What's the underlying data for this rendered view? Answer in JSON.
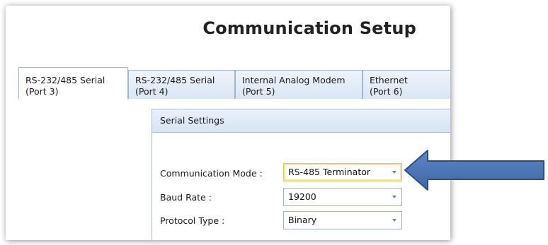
{
  "window": {
    "title": "Communication Setup"
  },
  "tabs": [
    {
      "line1": "RS-232/485 Serial",
      "line2": "(Port 3)",
      "active": true
    },
    {
      "line1": "RS-232/485 Serial",
      "line2": "(Port 4)",
      "active": false
    },
    {
      "line1": "Internal Analog Modem",
      "line2": "(Port 5)",
      "active": false
    },
    {
      "line1": "Ethernet",
      "line2": "(Port 6)",
      "active": false
    }
  ],
  "serial_settings": {
    "header": "Serial Settings",
    "communication_mode": {
      "label": "Communication Mode :",
      "value": "RS-485 Terminator"
    },
    "baud_rate": {
      "label": "Baud Rate :",
      "value": "19200"
    },
    "protocol_type": {
      "label": "Protocol Type :",
      "value": "Binary"
    }
  },
  "annotation": {
    "icon": "left-arrow-icon",
    "color": "#4a74b4"
  }
}
